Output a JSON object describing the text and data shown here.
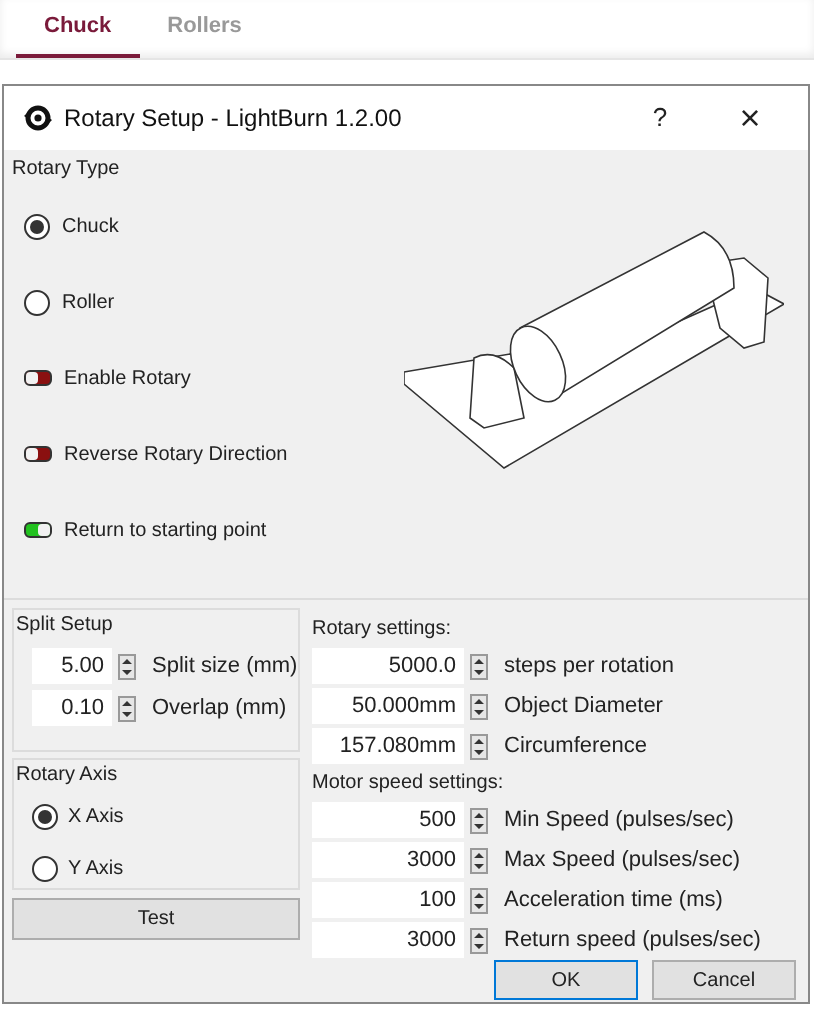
{
  "tabs": [
    {
      "label": "Chuck",
      "selected": true
    },
    {
      "label": "Rollers",
      "selected": false
    }
  ],
  "window": {
    "title": "Rotary Setup - LightBurn 1.2.00",
    "help": "?",
    "close": "×"
  },
  "rotary_type": {
    "title": "Rotary Type",
    "options": [
      {
        "kind": "radio",
        "label": "Chuck",
        "selected": true
      },
      {
        "kind": "radio",
        "label": "Roller",
        "selected": false
      },
      {
        "kind": "toggle",
        "label": "Enable Rotary",
        "on": false
      },
      {
        "kind": "toggle",
        "label": "Reverse Rotary Direction",
        "on": false
      },
      {
        "kind": "toggle",
        "label": "Return to starting point",
        "on": true
      }
    ]
  },
  "split_setup": {
    "title": "Split Setup",
    "fields": [
      {
        "value": "5.00",
        "label": "Split size (mm)"
      },
      {
        "value": "0.10",
        "label": "Overlap (mm)"
      }
    ]
  },
  "rotary_axis": {
    "title": "Rotary Axis",
    "options": [
      {
        "label": "X Axis",
        "selected": true
      },
      {
        "label": "Y Axis",
        "selected": false
      }
    ]
  },
  "test_button": "Test",
  "rotary_settings": {
    "title": "Rotary settings:",
    "fields": [
      {
        "value": "5000.0",
        "label": "steps per rotation"
      },
      {
        "value": "50.000mm",
        "label": "Object Diameter"
      },
      {
        "value": "157.080mm",
        "label": "Circumference"
      }
    ]
  },
  "motor_speed_settings": {
    "title": "Motor speed settings:",
    "fields": [
      {
        "value": "500",
        "label": "Min Speed (pulses/sec)"
      },
      {
        "value": "3000",
        "label": "Max Speed (pulses/sec)"
      },
      {
        "value": "100",
        "label": "Acceleration time (ms)"
      },
      {
        "value": "3000",
        "label": "Return speed (pulses/sec)"
      }
    ]
  },
  "buttons": [
    {
      "label": "OK",
      "default": true
    },
    {
      "label": "Cancel",
      "default": false
    }
  ]
}
